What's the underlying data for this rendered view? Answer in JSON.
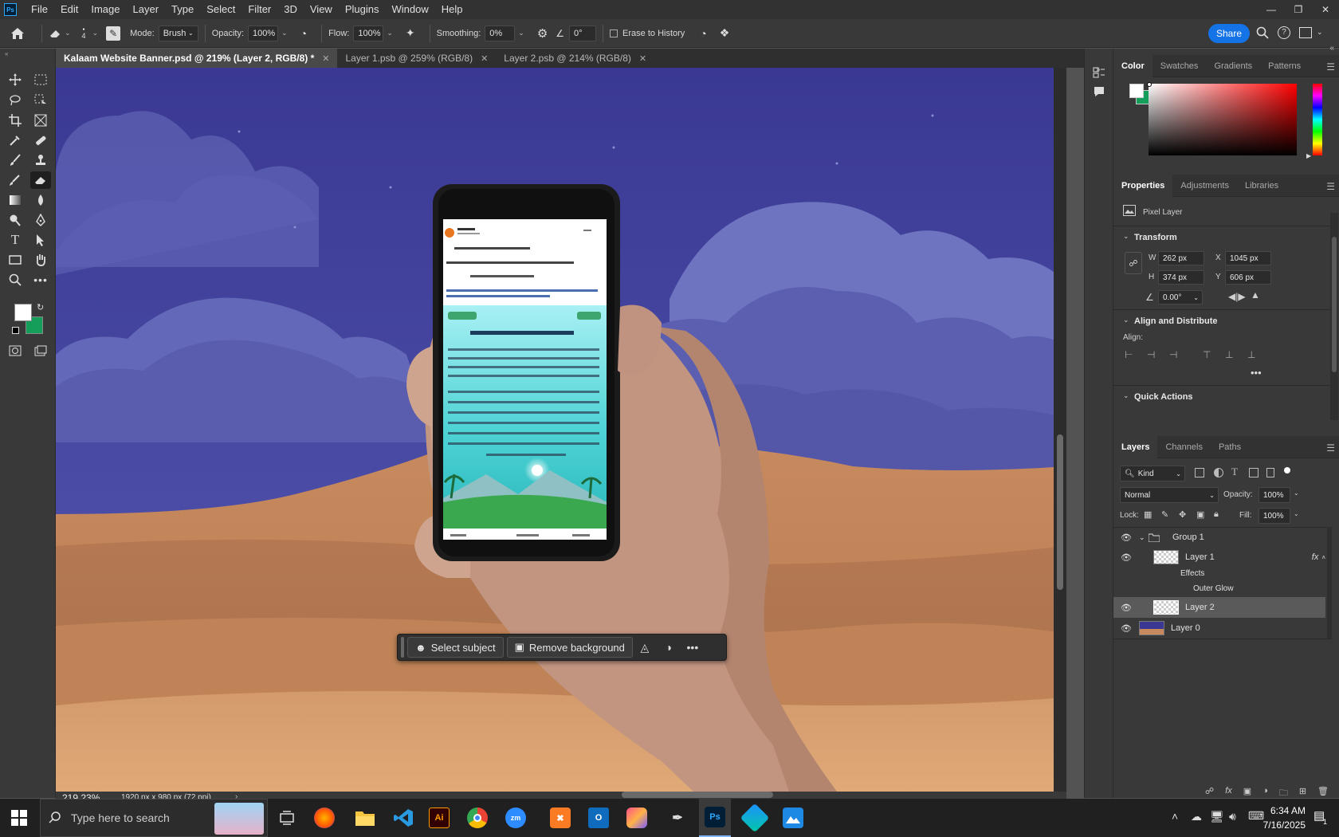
{
  "menu": [
    "File",
    "Edit",
    "Image",
    "Layer",
    "Type",
    "Select",
    "Filter",
    "3D",
    "View",
    "Plugins",
    "Window",
    "Help"
  ],
  "options": {
    "brush_size": "4",
    "mode_label": "Mode:",
    "mode_value": "Brush",
    "opacity_label": "Opacity:",
    "opacity_value": "100%",
    "flow_label": "Flow:",
    "flow_value": "100%",
    "smoothing_label": "Smoothing:",
    "smoothing_value": "0%",
    "angle_value": "0°",
    "erase_history_label": "Erase to History",
    "share_label": "Share"
  },
  "tabs": [
    {
      "label": "Kalaam Website Banner.psd @ 219% (Layer 2, RGB/8) *"
    },
    {
      "label": "Layer 1.psb @ 259% (RGB/8)"
    },
    {
      "label": "Layer 2.psb @ 214% (RGB/8)"
    }
  ],
  "context_bar": {
    "select_subject": "Select subject",
    "remove_background": "Remove background"
  },
  "phone_post": {
    "page_name": "Kalaam",
    "header_line": "کیا آپ اللہ سے محبت کرتے ہیں؟",
    "title": "صحابہ سے محبت ایمان کا حصہ ہے",
    "actions": [
      "Like",
      "Comment",
      "Share"
    ]
  },
  "status": {
    "zoom": "219.23%",
    "doc_info": "1920 px x 980 px (72 ppi)"
  },
  "color_panel": {
    "tabs": [
      "Color",
      "Swatches",
      "Gradients",
      "Patterns"
    ],
    "fg_color": "#ffffff",
    "bg_color": "#149e5a"
  },
  "properties": {
    "tabs": [
      "Properties",
      "Adjustments",
      "Libraries"
    ],
    "kind": "Pixel Layer",
    "transform_title": "Transform",
    "w_label": "W",
    "w_value": "262 px",
    "x_label": "X",
    "x_value": "1045 px",
    "h_label": "H",
    "h_value": "374 px",
    "y_label": "Y",
    "y_value": "606 px",
    "angle_value": "0.00°",
    "align_title": "Align and Distribute",
    "align_label": "Align:",
    "quick_actions_title": "Quick Actions"
  },
  "layers_panel": {
    "tabs": [
      "Layers",
      "Channels",
      "Paths"
    ],
    "filter_kind": "Kind",
    "blend_mode": "Normal",
    "opacity_label": "Opacity:",
    "opacity_value": "100%",
    "lock_label": "Lock:",
    "fill_label": "Fill:",
    "fill_value": "100%",
    "layers": [
      {
        "name": "Group 1"
      },
      {
        "name": "Layer 1"
      },
      {
        "name": "Effects"
      },
      {
        "name": "Outer Glow"
      },
      {
        "name": "Layer 2"
      },
      {
        "name": "Layer 0"
      }
    ]
  },
  "taskbar": {
    "search_placeholder": "Type here to search",
    "time": "6:34 AM",
    "date": "7/16/2025",
    "notification_count": "1"
  }
}
